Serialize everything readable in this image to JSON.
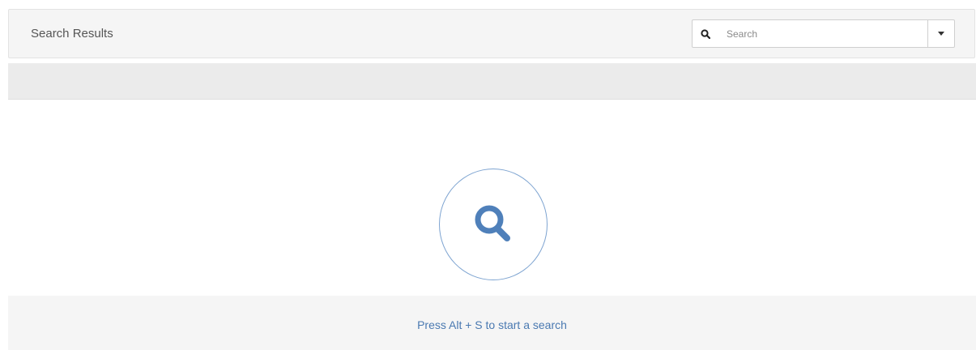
{
  "header": {
    "title": "Search Results"
  },
  "search": {
    "placeholder": "Search",
    "value": "",
    "icon": "search-icon",
    "dropdown_icon": "caret-down-icon"
  },
  "empty_state": {
    "icon": "search-icon",
    "hint": "Press Alt + S to start a search"
  },
  "colors": {
    "accent": "#4a79b1",
    "icon_blue": "#4f80ba",
    "circle_border": "#7ea4d1",
    "header_bg": "#f5f5f5",
    "band_bg": "#ebebeb"
  }
}
